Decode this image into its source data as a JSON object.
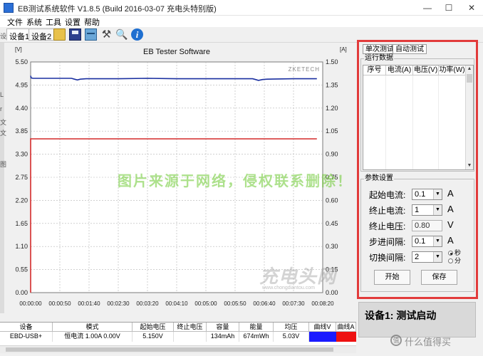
{
  "window": {
    "title": "EB测试系统软件 V1.8.5 (Build 2016-03-07 充电头特别版)",
    "min_glyph": "—",
    "max_glyph": "☐",
    "close_glyph": "✕"
  },
  "menu": [
    "文件",
    "系统",
    "工具",
    "设置",
    "帮助"
  ],
  "toolbar": {
    "device_tabs": [
      "设备1",
      "设备2"
    ],
    "tools_glyph": "⚒",
    "zoom_glyph": "🔍",
    "info_glyph": "i"
  },
  "left_edge_glyphs": [
    "设",
    "L",
    "r",
    "文",
    "文",
    "图"
  ],
  "chart": {
    "title": "EB Tester Software",
    "brand": "ZKETECH",
    "left_unit": "[V]",
    "right_unit": "[A]",
    "colors": {
      "voltage": "#1a2fa0",
      "current": "#d42a2a",
      "grid": "#b5b5b5"
    }
  },
  "chart_data": {
    "type": "line",
    "title": "EB Tester Software",
    "y_left": {
      "label": "[V]",
      "lim": [
        0,
        5.5
      ],
      "ticks": [
        "0.00",
        "0.55",
        "1.10",
        "1.65",
        "2.20",
        "2.75",
        "3.30",
        "3.85",
        "4.40",
        "4.95",
        "5.50"
      ]
    },
    "y_right": {
      "label": "[A]",
      "lim": [
        0,
        1.5
      ],
      "ticks": [
        "0.00",
        "0.15",
        "0.30",
        "0.45",
        "0.60",
        "0.75",
        "0.90",
        "1.05",
        "1.20",
        "1.35",
        "1.50"
      ]
    },
    "x": {
      "ticks": [
        "00:00:00",
        "00:00:50",
        "00:01:40",
        "00:02:30",
        "00:03:20",
        "00:04:10",
        "00:05:00",
        "00:05:50",
        "00:06:40",
        "00:07:30",
        "00:08:20"
      ],
      "lim_seconds": [
        0,
        500
      ]
    },
    "grid": true,
    "series": [
      {
        "axis": "left",
        "color": "#1a2fa0",
        "points": [
          [
            0,
            5.17
          ],
          [
            1,
            5.12
          ],
          [
            4,
            5.11
          ],
          [
            30,
            5.11
          ],
          [
            70,
            5.11
          ],
          [
            75,
            5.09
          ],
          [
            80,
            5.07
          ],
          [
            85,
            5.09
          ],
          [
            95,
            5.1
          ],
          [
            150,
            5.1
          ],
          [
            200,
            5.11
          ],
          [
            250,
            5.1
          ],
          [
            300,
            5.1
          ],
          [
            380,
            5.1
          ],
          [
            385,
            5.08
          ],
          [
            390,
            5.06
          ],
          [
            397,
            5.08
          ],
          [
            405,
            5.09
          ],
          [
            450,
            5.1
          ],
          [
            490,
            5.1
          ]
        ]
      },
      {
        "axis": "right",
        "color": "#d42a2a",
        "points": [
          [
            0,
            0
          ],
          [
            0,
            1.0
          ],
          [
            490,
            1.0
          ]
        ]
      }
    ]
  },
  "side": {
    "tabs": [
      "单次测试",
      "自动测试"
    ],
    "run_group": "运行数据",
    "run_columns": [
      "序号",
      "电流(A)",
      "电压(V)",
      "功率(W)"
    ],
    "param_group": "参数设置",
    "params": [
      {
        "label": "起始电流:",
        "value": "0.1",
        "unit": "A",
        "kind": "select"
      },
      {
        "label": "终止电流:",
        "value": "1",
        "unit": "A",
        "kind": "select"
      },
      {
        "label": "终止电压:",
        "value": "0.80",
        "unit": "V",
        "kind": "input"
      },
      {
        "label": "步进间隔:",
        "value": "0.1",
        "unit": "A",
        "kind": "select"
      },
      {
        "label": "切换间隔:",
        "value": "2",
        "unit": "",
        "kind": "select"
      }
    ],
    "radio_labels": [
      "秒",
      "分"
    ],
    "start_label": "开始",
    "save_label": "保存",
    "accent_color": "#e23b3b"
  },
  "status": {
    "text": "设备1: 测试启动"
  },
  "table": {
    "headers": [
      "设备",
      "模式",
      "起始电压",
      "终止电压",
      "容量",
      "能量",
      "均压",
      "曲线V",
      "曲线A"
    ],
    "row": [
      "EBD-USB+",
      "恒电流 1.00A 0.00V",
      "5.150V",
      "",
      "134mAh",
      "674mWh",
      "5.03V"
    ],
    "swatch_v": "#1a1aff",
    "swatch_a": "#ee1111"
  },
  "watermarks": {
    "notice": "图片来源于网络，侵权联系删除！",
    "logo": "充电头网",
    "url": "www.chongdiantou.com",
    "corner": "什么值得买",
    "corner_icon": "值"
  }
}
